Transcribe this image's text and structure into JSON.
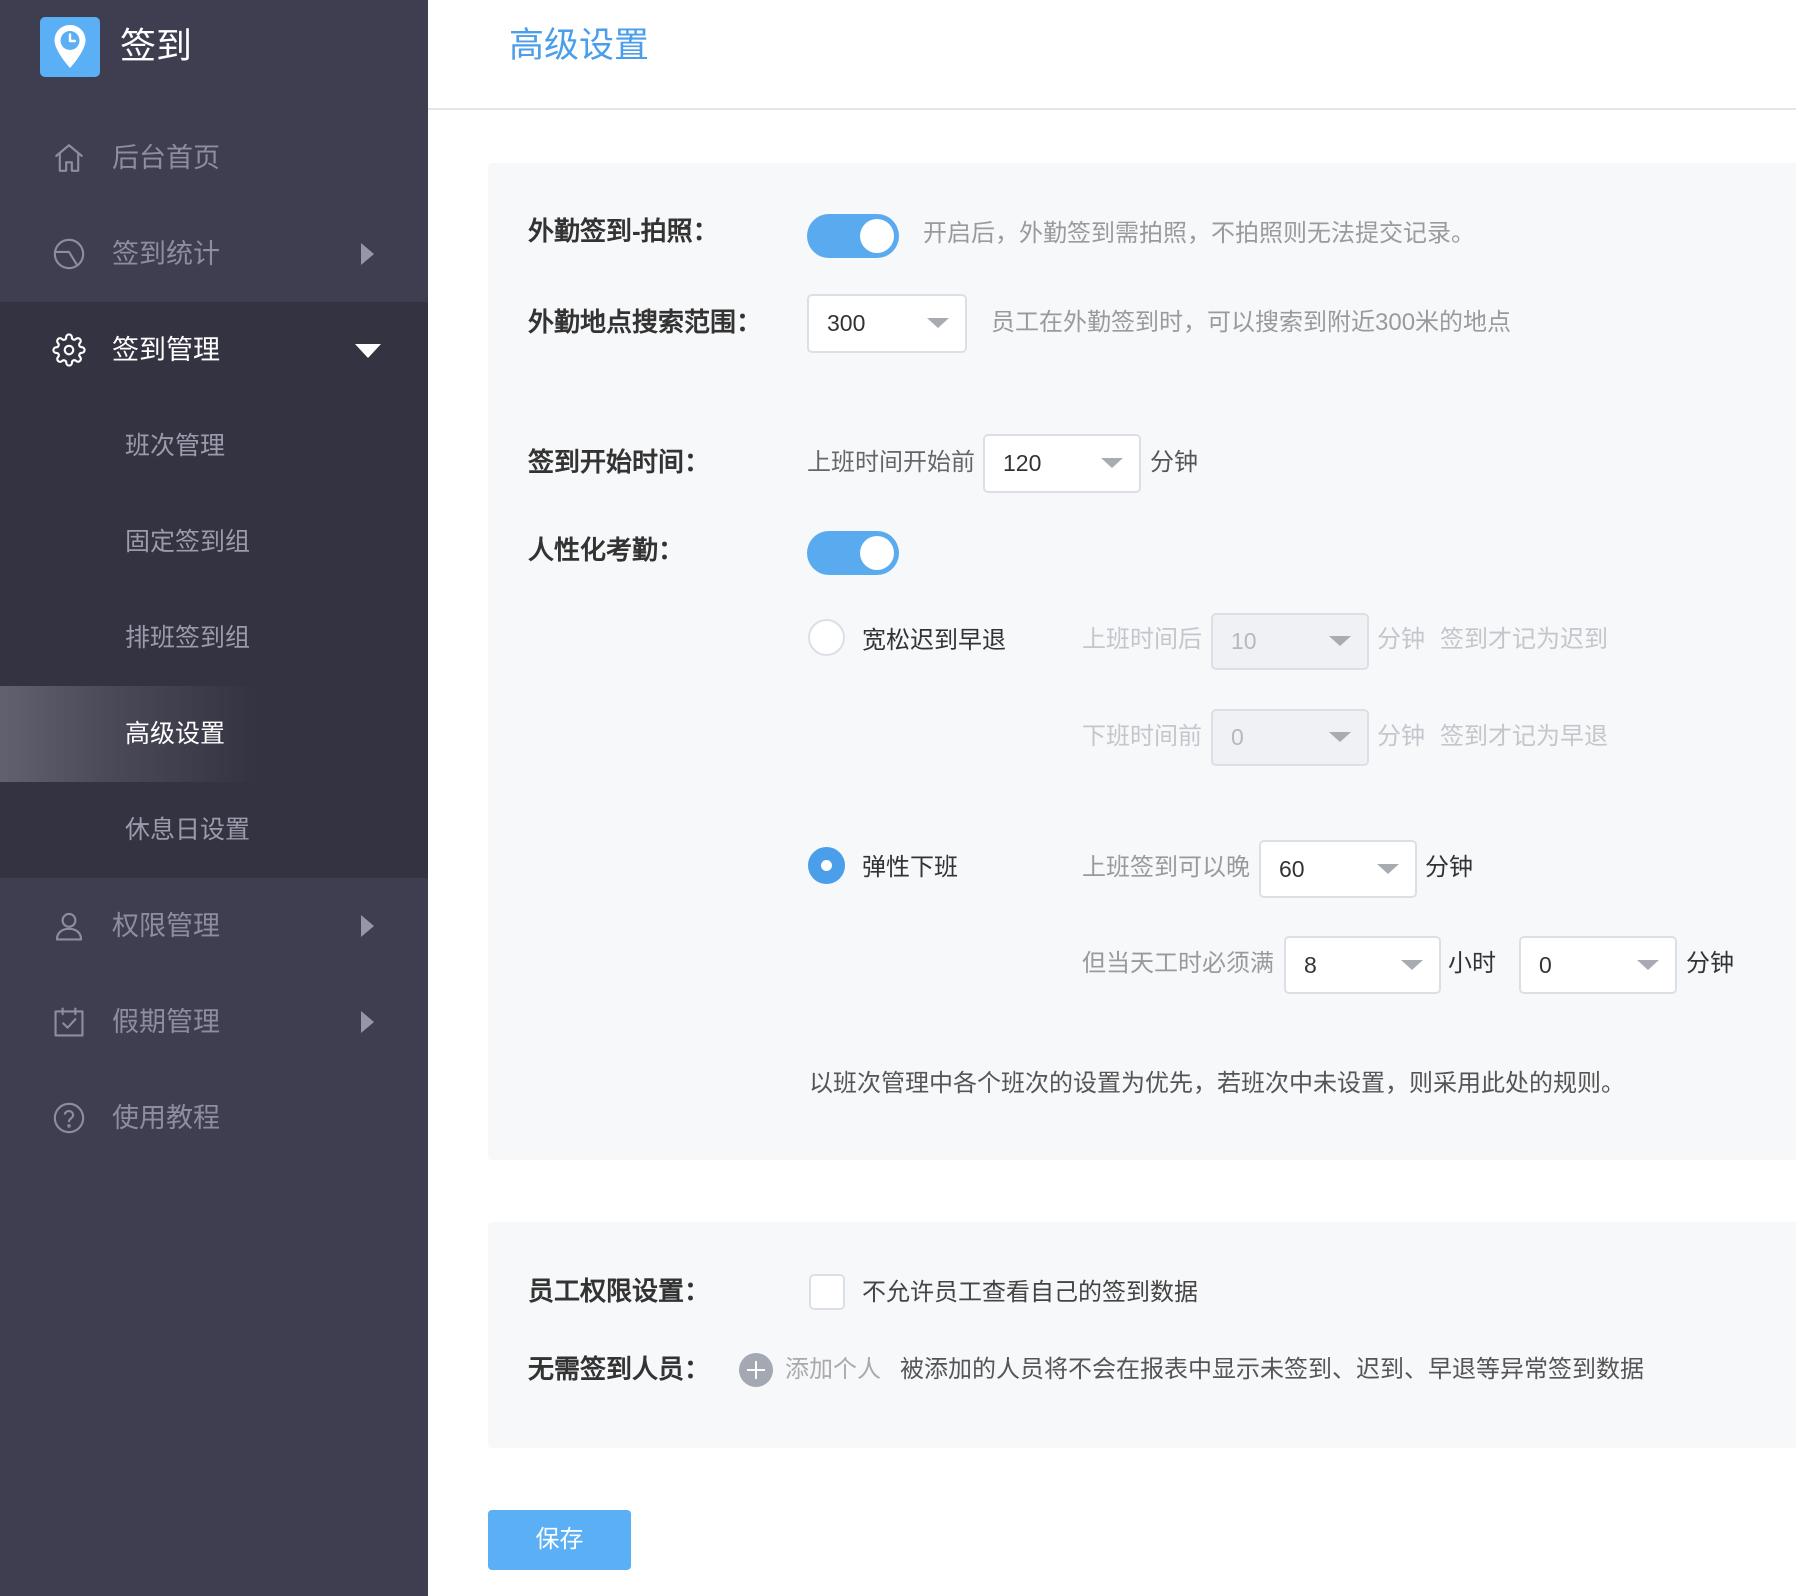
{
  "app": {
    "title": "签到",
    "logo_icon": "location-clock-icon"
  },
  "sidebar": {
    "items": [
      {
        "label": "后台首页",
        "icon": "home-icon"
      },
      {
        "label": "签到统计",
        "icon": "pie-chart-icon",
        "arrow": "caret-right-icon"
      },
      {
        "label": "签到管理",
        "icon": "gear-icon",
        "arrow": "caret-down-icon",
        "expanded": true,
        "children": [
          {
            "label": "班次管理",
            "active": false
          },
          {
            "label": "固定签到组",
            "active": false
          },
          {
            "label": "排班签到组",
            "active": false
          },
          {
            "label": "高级设置",
            "active": true
          },
          {
            "label": "休息日设置",
            "active": false
          }
        ]
      },
      {
        "label": "权限管理",
        "icon": "user-icon",
        "arrow": "caret-right-icon"
      },
      {
        "label": "假期管理",
        "icon": "calendar-check-icon",
        "arrow": "caret-right-icon"
      },
      {
        "label": "使用教程",
        "icon": "help-circle-icon"
      }
    ]
  },
  "header": {
    "title": "高级设置"
  },
  "settings": {
    "field_photo": {
      "label": "外勤签到-拍照：",
      "enabled": true,
      "hint": "开启后，外勤签到需拍照，不拍照则无法提交记录。"
    },
    "field_range": {
      "label": "外勤地点搜索范围：",
      "value": "300",
      "hint": "员工在外勤签到时，可以搜索到附近300米的地点"
    },
    "checkin_start": {
      "label": "签到开始时间：",
      "prefix": "上班时间开始前",
      "value": "120",
      "unit": "分钟"
    },
    "humane": {
      "label": "人性化考勤：",
      "enabled": true,
      "lenient": {
        "label": "宽松迟到早退",
        "selected": false,
        "late": {
          "prefix": "上班时间后",
          "value": "10",
          "unit": "分钟",
          "suffix": "签到才记为迟到"
        },
        "early": {
          "prefix": "下班时间前",
          "value": "0",
          "unit": "分钟",
          "suffix": "签到才记为早退"
        }
      },
      "flexible": {
        "label": "弹性下班",
        "selected": true,
        "late_allow": {
          "prefix": "上班签到可以晚",
          "value": "60",
          "unit": "分钟"
        },
        "min_hours": {
          "prefix": "但当天工时必须满",
          "hours": "8",
          "hours_unit": "小时",
          "minutes": "0",
          "minutes_unit": "分钟"
        }
      },
      "note": "以班次管理中各个班次的设置为优先，若班次中未设置，则采用此处的规则。"
    },
    "employee_permission": {
      "label": "员工权限设置：",
      "checkbox_label": "不允许员工查看自己的签到数据",
      "checked": false
    },
    "exempt": {
      "label": "无需签到人员：",
      "add_label": "添加个人",
      "add_icon": "plus-circle-icon",
      "hint": "被添加的人员将不会在报表中显示未签到、迟到、早退等异常签到数据"
    }
  },
  "actions": {
    "save_label": "保存"
  },
  "theme": {
    "accent": "#4a9eea",
    "sidebar_bg": "#3f3e51",
    "sidebar_group_bg": "#343341",
    "toggle_on": "#5aaaf0",
    "button_bg": "#5aaff5",
    "card_bg": "#f7f8fa"
  }
}
